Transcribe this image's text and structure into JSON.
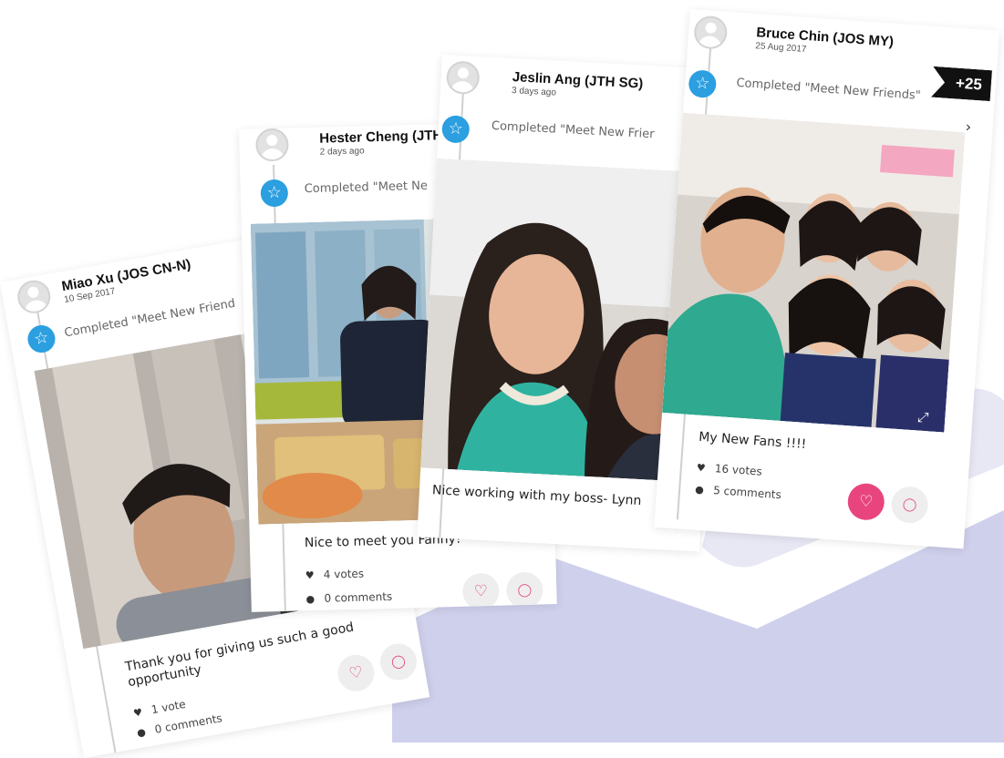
{
  "posts": [
    {
      "author": "Miao  Xu (JOS CN-N)",
      "date": "10 Sep 2017",
      "activity": "Completed \"Meet New Friend",
      "caption_line1": "Thank you for giving us such a good",
      "caption_line2": "opportunity",
      "votes": "1 vote",
      "comments": "0 comments"
    },
    {
      "author": "Hester Cheng (JTH",
      "date": "2 days ago",
      "activity": "Completed \"Meet Ne",
      "caption": "Nice to meet you Fanny!",
      "votes": "4 votes",
      "comments": "0 comments"
    },
    {
      "author": "Jeslin Ang (JTH SG)",
      "date": "3 days ago",
      "activity": "Completed \"Meet New Frier",
      "caption": "Nice working with my boss- Lynn"
    },
    {
      "author": "Bruce Chin (JOS MY)",
      "date": "25 Aug 2017",
      "activity": "Completed \"Meet New Friends\"",
      "caption": "My New Fans !!!!",
      "votes": "16 votes",
      "comments": "5 comments",
      "badge": "+25"
    }
  ],
  "icons": {
    "star": "☆",
    "heart": "♡",
    "comment": "◯",
    "vote": "♥",
    "comment_dot": "●",
    "chevron": "›",
    "expand": "⤢"
  },
  "colors": {
    "accent_blue": "#2b9fe0",
    "like_pink": "#e8457e",
    "background_shape": "#cfd0ec"
  }
}
